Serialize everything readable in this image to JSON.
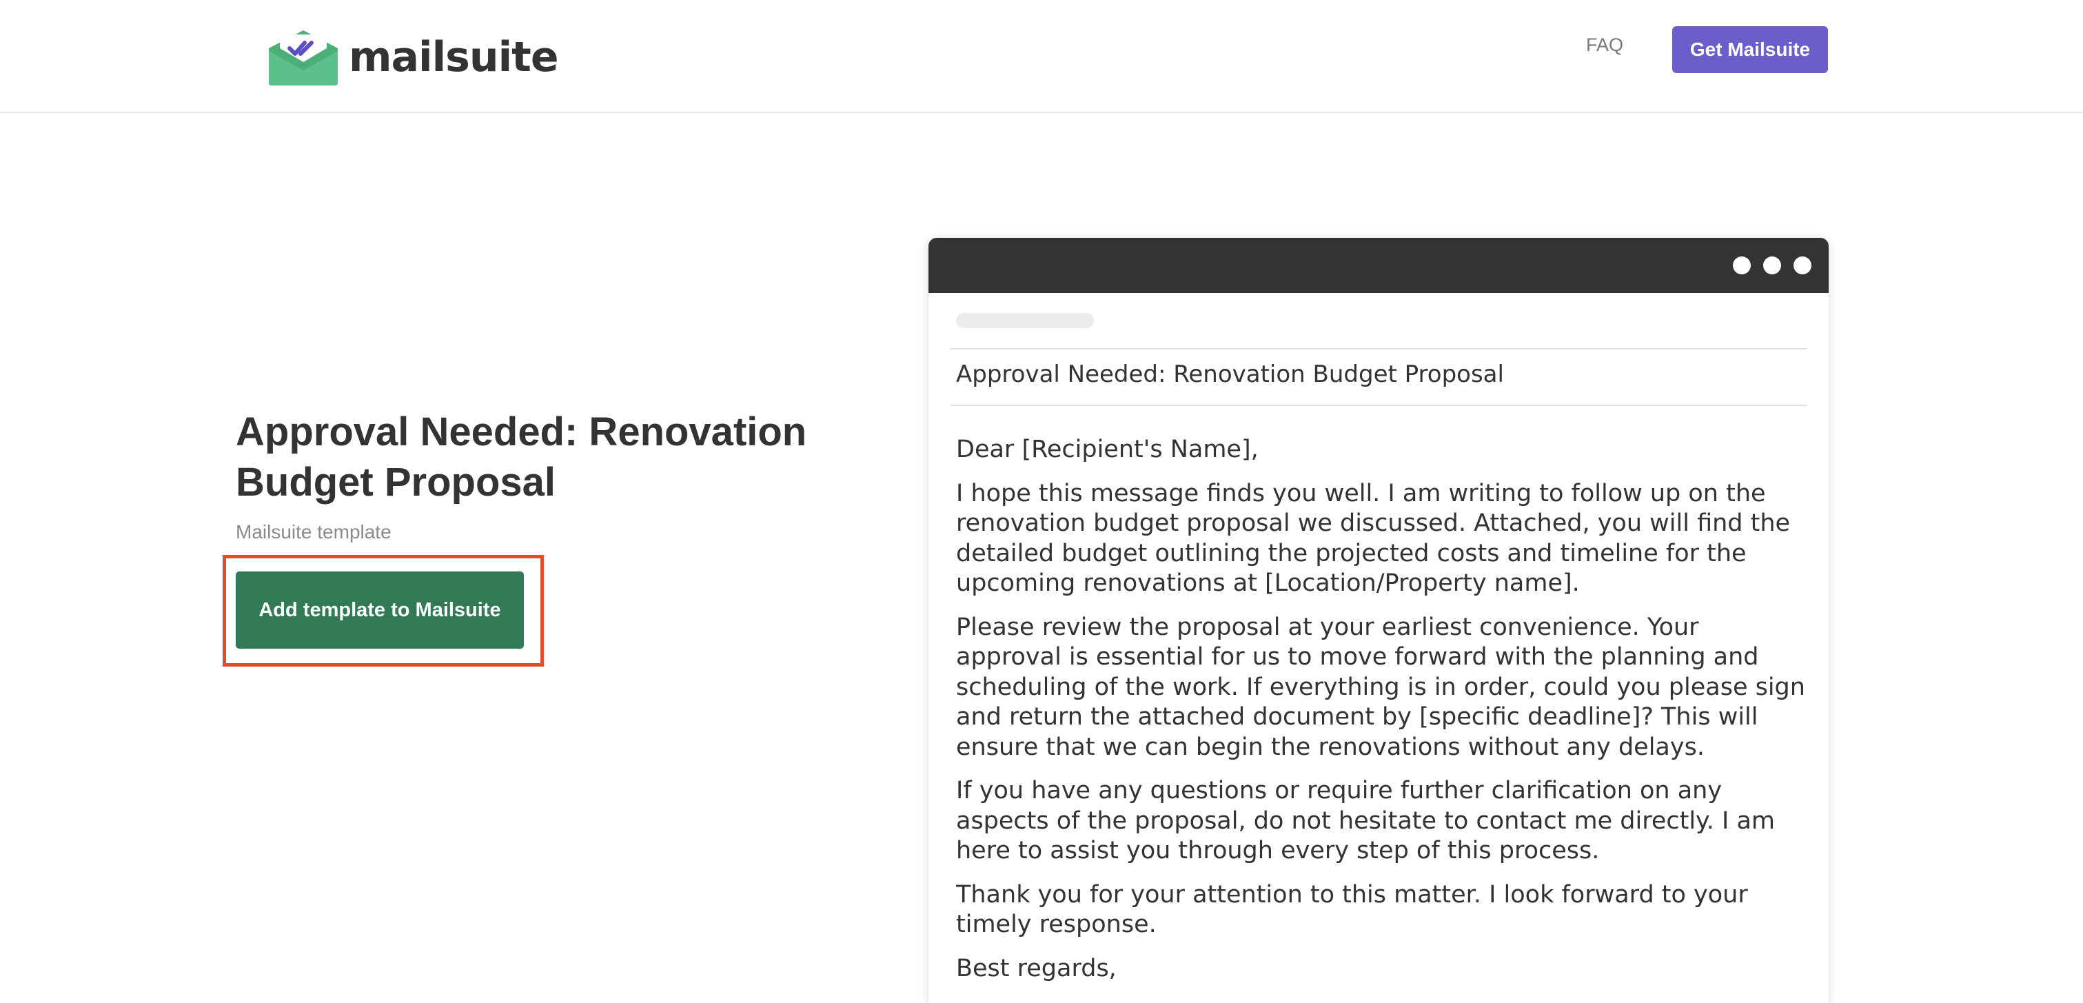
{
  "header": {
    "logo_text": "mailsuite",
    "faq_label": "FAQ",
    "cta_label": "Get Mailsuite",
    "logo_icon": "envelope-check-icon"
  },
  "template": {
    "title": "Approval Needed: Renovation Budget Proposal",
    "subtitle": "Mailsuite template",
    "add_button_label": "Add template to Mailsuite"
  },
  "email": {
    "subject": "Approval Needed: Renovation Budget Proposal",
    "paragraphs": [
      "Dear [Recipient's Name],",
      "I hope this message finds you well. I am writing to follow up on the renovation budget proposal we discussed. Attached, you will find the detailed budget outlining the projected costs and timeline for the upcoming renovations at [Location/Property name].",
      "Please review the proposal at your earliest convenience. Your approval is essential for us to move forward with the planning and scheduling of the work. If everything is in order, could you please sign and return the attached document by [specific deadline]? This will ensure that we can begin the renovations without any delays.",
      "If you have any questions or require further clarification on any aspects of the proposal, do not hesitate to contact me directly. I am here to assist you through every step of this process.",
      "Thank you for your attention to this matter. I look forward to your timely response.",
      "Best regards,"
    ]
  },
  "colors": {
    "brand_purple": "#6a5fc8",
    "brand_green": "#327a55",
    "logo_green": "#4caf78",
    "highlight_red": "#e34b2f",
    "window_bar": "#333333"
  }
}
